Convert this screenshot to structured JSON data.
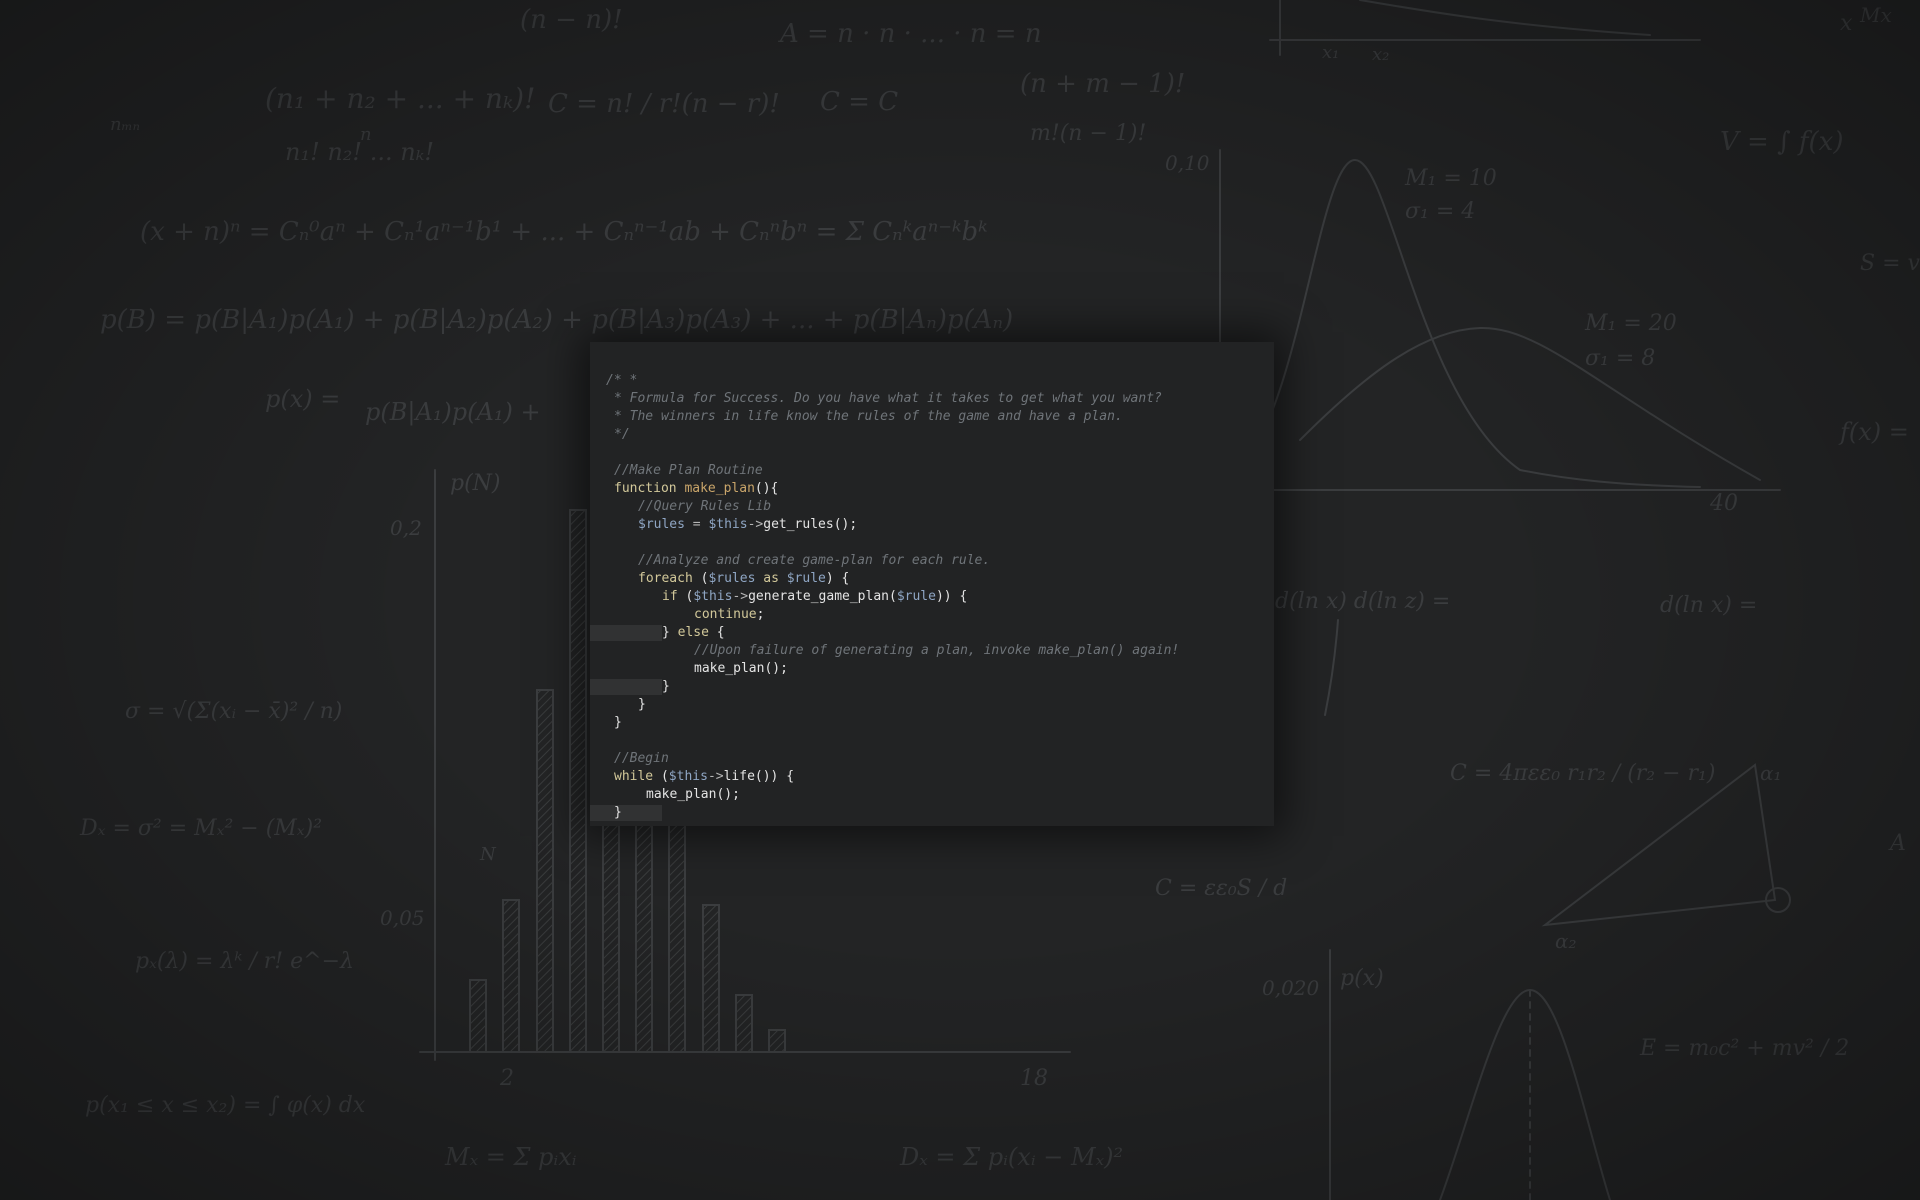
{
  "code_editor": {
    "lines": [
      {
        "indent": 0,
        "tokens": [
          {
            "t": "/* *",
            "c": "comment"
          }
        ]
      },
      {
        "indent": 1,
        "tokens": [
          {
            "t": "* Formula for Success. Do you have what it takes to get what you want?",
            "c": "comment"
          }
        ]
      },
      {
        "indent": 1,
        "tokens": [
          {
            "t": "* The winners in life know the rules of the game and have a plan.",
            "c": "comment"
          }
        ]
      },
      {
        "indent": 1,
        "tokens": [
          {
            "t": "*/",
            "c": "comment"
          }
        ]
      },
      {
        "indent": 0,
        "tokens": []
      },
      {
        "indent": 1,
        "tokens": [
          {
            "t": "//Make Plan Routine",
            "c": "comment"
          }
        ]
      },
      {
        "indent": 1,
        "tokens": [
          {
            "t": "function",
            "c": "kw"
          },
          {
            "t": " ",
            "c": "plain"
          },
          {
            "t": "make_plan",
            "c": "fn"
          },
          {
            "t": "(){",
            "c": "plain"
          }
        ]
      },
      {
        "indent": 2,
        "tokens": [
          {
            "t": "//Query Rules Lib",
            "c": "comment"
          }
        ]
      },
      {
        "indent": 2,
        "tokens": [
          {
            "t": "$rules",
            "c": "var"
          },
          {
            "t": " = ",
            "c": "op"
          },
          {
            "t": "$this",
            "c": "var"
          },
          {
            "t": "->",
            "c": "op"
          },
          {
            "t": "get_rules",
            "c": "plain"
          },
          {
            "t": "();",
            "c": "plain"
          }
        ]
      },
      {
        "indent": 0,
        "tokens": []
      },
      {
        "indent": 2,
        "tokens": [
          {
            "t": "//Analyze and create game-plan for each rule.",
            "c": "comment"
          }
        ]
      },
      {
        "indent": 2,
        "tokens": [
          {
            "t": "foreach",
            "c": "kw"
          },
          {
            "t": " (",
            "c": "plain"
          },
          {
            "t": "$rules",
            "c": "var"
          },
          {
            "t": " ",
            "c": "plain"
          },
          {
            "t": "as",
            "c": "kw"
          },
          {
            "t": " ",
            "c": "plain"
          },
          {
            "t": "$rule",
            "c": "var"
          },
          {
            "t": ") {",
            "c": "plain"
          }
        ]
      },
      {
        "indent": 3,
        "tokens": [
          {
            "t": "if",
            "c": "kw"
          },
          {
            "t": " (",
            "c": "plain"
          },
          {
            "t": "$this",
            "c": "var"
          },
          {
            "t": "->",
            "c": "op"
          },
          {
            "t": "generate_game_plan",
            "c": "plain"
          },
          {
            "t": "(",
            "c": "plain"
          },
          {
            "t": "$rule",
            "c": "var"
          },
          {
            "t": ")) {",
            "c": "plain"
          }
        ]
      },
      {
        "indent": 4,
        "tokens": [
          {
            "t": "continue",
            "c": "kw"
          },
          {
            "t": ";",
            "c": "plain"
          }
        ]
      },
      {
        "indent": 3,
        "gutter": true,
        "tokens": [
          {
            "t": "} ",
            "c": "plain"
          },
          {
            "t": "else",
            "c": "kw"
          },
          {
            "t": " {",
            "c": "plain"
          }
        ]
      },
      {
        "indent": 4,
        "tokens": [
          {
            "t": "//Upon failure of generating a plan, invoke make_plan() again!",
            "c": "comment"
          }
        ]
      },
      {
        "indent": 4,
        "tokens": [
          {
            "t": "make_plan",
            "c": "plain"
          },
          {
            "t": "();",
            "c": "plain"
          }
        ]
      },
      {
        "indent": 3,
        "gutter": true,
        "tokens": [
          {
            "t": "}",
            "c": "plain"
          }
        ]
      },
      {
        "indent": 2,
        "tokens": [
          {
            "t": "}",
            "c": "plain"
          }
        ]
      },
      {
        "indent": 1,
        "tokens": [
          {
            "t": "}",
            "c": "plain"
          }
        ]
      },
      {
        "indent": 0,
        "tokens": []
      },
      {
        "indent": 1,
        "tokens": [
          {
            "t": "//Begin",
            "c": "comment"
          }
        ]
      },
      {
        "indent": 1,
        "tokens": [
          {
            "t": "while",
            "c": "kw"
          },
          {
            "t": " (",
            "c": "plain"
          },
          {
            "t": "$this",
            "c": "var"
          },
          {
            "t": "->",
            "c": "op"
          },
          {
            "t": "life",
            "c": "plain"
          },
          {
            "t": "()) {",
            "c": "plain"
          }
        ]
      },
      {
        "indent": 5,
        "tokens": [
          {
            "t": "make_plan",
            "c": "plain"
          },
          {
            "t": "();",
            "c": "plain"
          }
        ]
      },
      {
        "indent": 1,
        "gutter": true,
        "tokens": [
          {
            "t": "}",
            "c": "plain"
          }
        ]
      }
    ]
  },
  "colors": {
    "background": "#232425",
    "panel": "#222324",
    "comment": "#6f7479",
    "keyword": "#d2c89a",
    "function": "#c9a56a",
    "variable": "#8fa6c4",
    "plain": "#e4e4e4"
  },
  "background_image": {
    "formulas": [
      "(n − n)!",
      "A = n · n · ... · n = n",
      "(n₁ + n₂ + ... + nₖ)!",
      "n₁! n₂! ... nₖ!",
      "C = n! / r!(n − r)!",
      "C = C",
      "(n + m − 1)!",
      "m!(n − 1)!",
      "V = ∫ f(x)",
      "(x + n)ⁿ = Cₙ⁰aⁿ + Cₙ¹aⁿ⁻¹b¹ + ... + Cₙⁿ⁻¹ab + Cₙⁿbⁿ = Σ Cₙᵏaⁿ⁻ᵏbᵏ",
      "p(B) = p(B|A₁)p(A₁) + p(B|A₂)p(A₂) + p(B|A₃)p(A₃) + ... + p(B|Aₙ)p(Aₙ)",
      "p(x) =",
      "p(B|A₁)p(A₁) +",
      "σ = √(Σ(xᵢ − x̄)² / n)",
      "Dₓ = σ² = Mₓ² − (Mₓ)²",
      "pₓ(λ) = λᵏ / r! e^−λ",
      "p(x₁ ≤ x ≤ x₂) = ∫ φ(x) dx",
      "Mₓ = Σ pᵢxᵢ",
      "Dₓ = Σ pᵢ(xᵢ − Mₓ)²",
      "M₁ = 10",
      "σ₁ = 4",
      "M₁ = 20",
      "σ₁ = 8",
      "f(x) =",
      "S = v",
      "d(ln x) d(ln z) =",
      "d(ln x) =",
      "C = 4πεε₀ r₁r₂ / (r₂ − r₁)",
      "C = εε₀S / d",
      "E = m₀c² + mv² / 2",
      "p(x)",
      "p(N)",
      "0,10",
      "0,2",
      "0,05",
      "0,020",
      "2",
      "18",
      "40",
      "x",
      "x₁",
      "x₂",
      "N",
      "n",
      "nₘₙ",
      "A",
      "Mx",
      "α₁",
      "α₂"
    ]
  }
}
